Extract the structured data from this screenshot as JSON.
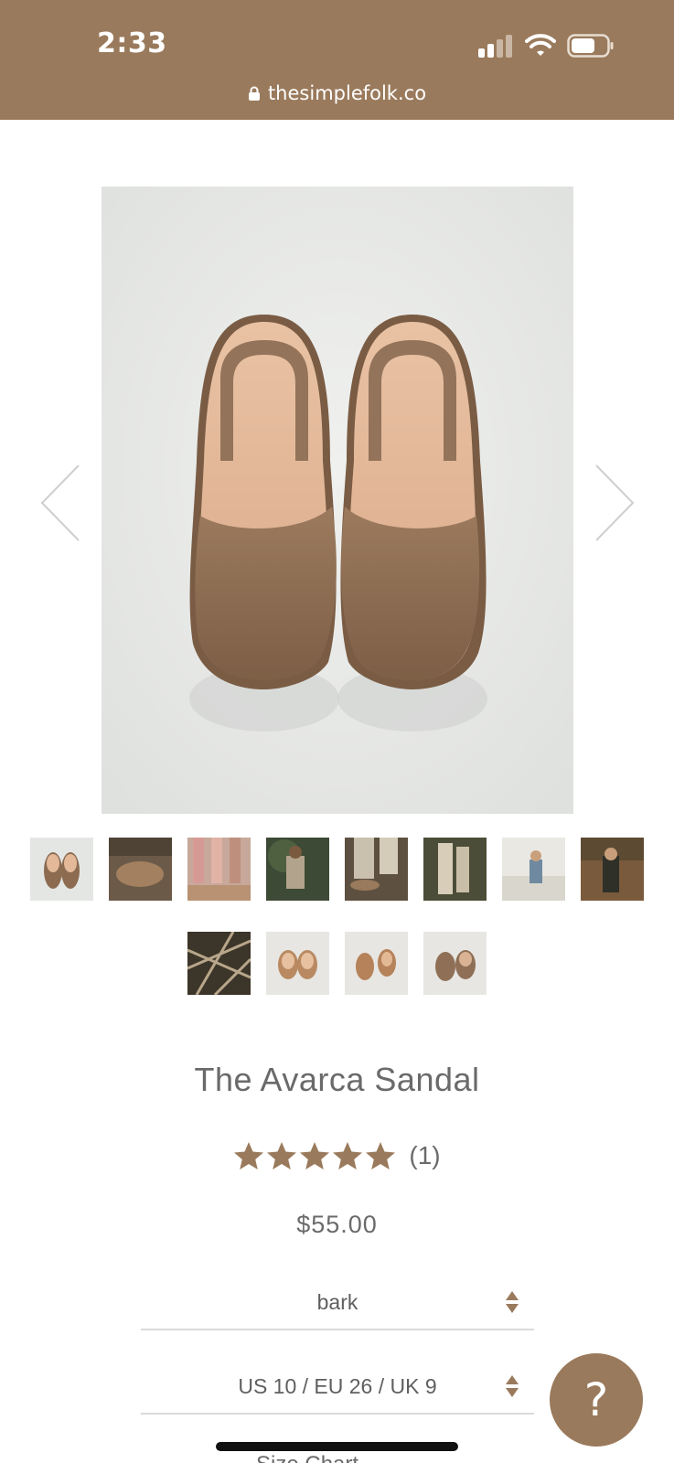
{
  "status": {
    "time": "2:33"
  },
  "browser": {
    "url": "thesimplefolk.co"
  },
  "product": {
    "title": "The Avarca Sandal",
    "rating_stars": 5,
    "review_count": "(1)",
    "price": "$55.00",
    "color_value": "bark",
    "size_value": "US 10 / EU 26 / UK 9",
    "size_chart_label": "Size Chart"
  },
  "help": {
    "label": "?"
  },
  "colors": {
    "brand": "#9a7a5c",
    "star": "#9a7a5c",
    "text": "#6a6a6a"
  },
  "icons": [
    "lock-icon",
    "chevron-left-icon",
    "chevron-right-icon",
    "star-icon",
    "updown-icon",
    "wifi-icon",
    "battery-icon",
    "signal-icon"
  ]
}
